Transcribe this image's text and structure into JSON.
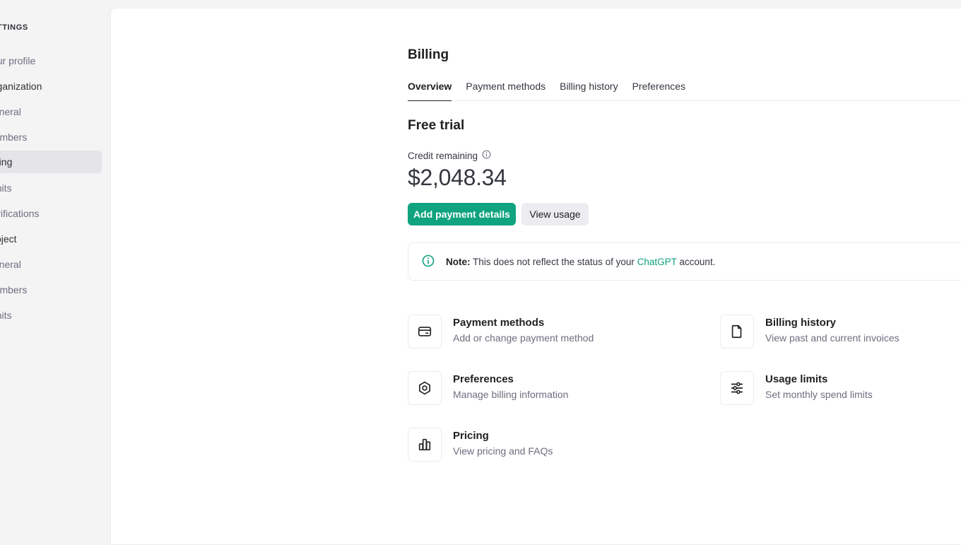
{
  "sidebar": {
    "heading": "SETTINGS",
    "items": [
      {
        "label": "Your profile"
      },
      {
        "label": "Organization"
      },
      {
        "label": "General"
      },
      {
        "label": "Members"
      },
      {
        "label": "Billing"
      },
      {
        "label": "Limits"
      },
      {
        "label": "Verifications"
      },
      {
        "label": "Project"
      },
      {
        "label": "General"
      },
      {
        "label": "Members"
      },
      {
        "label": "Limits"
      }
    ]
  },
  "main": {
    "title": "Billing",
    "tabs": [
      {
        "label": "Overview"
      },
      {
        "label": "Payment methods"
      },
      {
        "label": "Billing history"
      },
      {
        "label": "Preferences"
      }
    ],
    "section_title": "Free trial",
    "credit_label": "Credit remaining",
    "credit_amount": "$2,048.34",
    "add_payment_label": "Add payment details",
    "view_usage_label": "View usage",
    "note": {
      "prefix": "Note:",
      "text_before": " This does not reflect the status of your ",
      "link": "ChatGPT",
      "text_after": " account."
    },
    "cards": [
      {
        "title": "Payment methods",
        "subtitle": "Add or change payment method",
        "icon": "card-icon"
      },
      {
        "title": "Billing history",
        "subtitle": "View past and current invoices",
        "icon": "document-icon"
      },
      {
        "title": "Preferences",
        "subtitle": "Manage billing information",
        "icon": "gear-icon"
      },
      {
        "title": "Usage limits",
        "subtitle": "Set monthly spend limits",
        "icon": "sliders-icon"
      },
      {
        "title": "Pricing",
        "subtitle": "View pricing and FAQs",
        "icon": "bar-chart-icon"
      }
    ]
  },
  "colors": {
    "accent": "#10a37f",
    "sidebar_bg": "#f4f4f5",
    "active_item_bg": "#e4e4e9"
  }
}
